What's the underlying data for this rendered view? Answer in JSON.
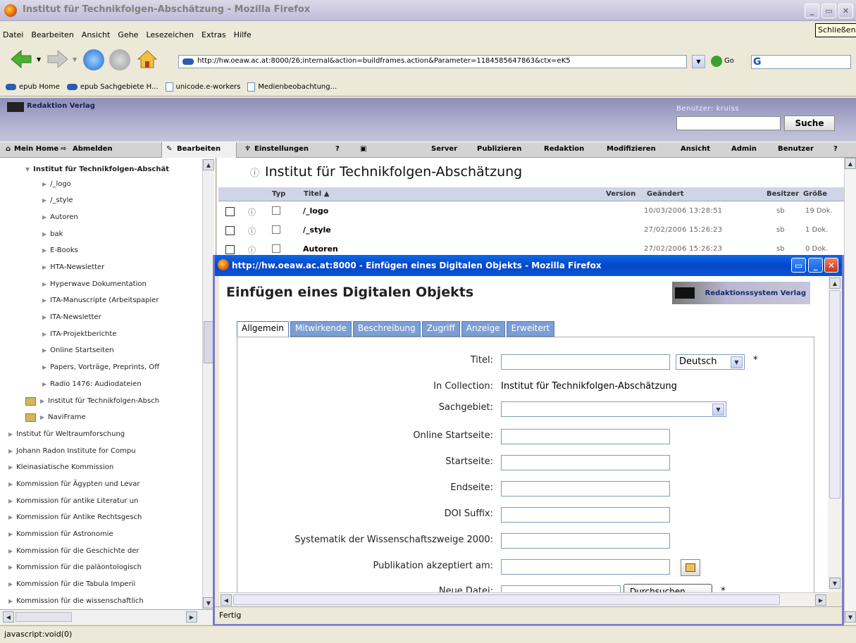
{
  "window": {
    "title": "Institut für Technikfolgen-Abschätzung - Mozilla Firefox",
    "tooltip": "Schließen"
  },
  "menu": [
    "Datei",
    "Bearbeiten",
    "Ansicht",
    "Gehe",
    "Lesezeichen",
    "Extras",
    "Hilfe"
  ],
  "nav": {
    "url": "http://hw.oeaw.ac.at:8000/26;internal&action=buildframes.action&Parameter=1184585647863&ctx=eK5",
    "go_label": "Go"
  },
  "bookmarks": [
    "epub Home",
    "epub Sachgebiete H...",
    "unicode.e-workers",
    "Medienbeobachtung..."
  ],
  "site": {
    "logo_text": "Redaktion Verlag",
    "user_label": "Benutzer: kruiss",
    "search_button": "Suche"
  },
  "appmenu": {
    "left": [
      "Mein Home",
      "Abmelden",
      "Bearbeiten",
      "Einstellungen"
    ],
    "right": [
      "Server",
      "Publizieren",
      "Redaktion",
      "Modifizieren",
      "Ansicht",
      "Admin",
      "Benutzer",
      "?"
    ]
  },
  "tree": {
    "items": [
      "Institut für Technikfolgen-Abschät",
      "/_logo",
      "/_style",
      "Autoren",
      "bak",
      "E-Books",
      "HTA-Newsletter",
      "Hyperwave Dokumentation",
      "ITA-Manuscripte (Arbeitspapier",
      "ITA-Newsletter",
      "ITA-Projektberichte",
      "Online Startseiten",
      "Papers, Vorträge, Preprints, Off",
      "Radio 1476: Audiodateien",
      "Institut für Technikfolgen-Absch",
      "NaviFrame",
      "Institut für Weltraumforschung",
      "Johann Radon Institute for Compu",
      "Kleinasiatische Kommission",
      "Kommission für Ägypten und Levar",
      "Kommission für antike Literatur un",
      "Kommission für Antike Rechtsgesch",
      "Kommission für Astronomie",
      "Kommission für die Geschichte der",
      "Kommission für die paläontologisch",
      "Kommission für die Tabula Imperii",
      "Kommission für die wissenschaftlich"
    ]
  },
  "main": {
    "title": "Institut für Technikfolgen-Abschätzung",
    "columns": {
      "typ": "Typ",
      "titel": "Titel ▲",
      "version": "Version",
      "geaendert": "Geändert",
      "besitzer": "Besitzer",
      "groesse": "Größe"
    },
    "rows": [
      {
        "name": "/_logo",
        "date": "10/03/2006 13:28:51",
        "owner": "sb",
        "size": "19 Dok."
      },
      {
        "name": "/_style",
        "date": "27/02/2006 15:26:23",
        "owner": "sb",
        "size": "1 Dok."
      },
      {
        "name": "Autoren",
        "date": "27/02/2006 15:26:23",
        "owner": "sb",
        "size": "0 Dok."
      }
    ]
  },
  "popup": {
    "title": "http://hw.oeaw.ac.at:8000 - Einfügen eines Digitalen Objekts - Mozilla Firefox",
    "heading": "Einfügen eines Digitalen Objekts",
    "logo_text": "Redaktionssystem Verlag",
    "tabs": [
      "Allgemein",
      "Mitwirkende",
      "Beschreibung",
      "Zugriff",
      "Anzeige",
      "Erweitert"
    ],
    "form": {
      "titel": "Titel:",
      "lang_value": "Deutsch",
      "required": "*",
      "in_collection": "In Collection:",
      "collection_value": "Institut für Technikfolgen-Abschätzung",
      "sachgebiet": "Sachgebiet:",
      "online_startseite": "Online Startseite:",
      "startseite": "Startseite:",
      "endseite": "Endseite:",
      "doi_suffix": "DOI Suffix:",
      "systematik": "Systematik der Wissenschaftszweige 2000:",
      "publikation": "Publikation akzeptiert am:",
      "neue_datei": "Neue Datei:",
      "browse": "Durchsuchen..."
    },
    "status": "Fertig"
  },
  "statusbar": "javascript:void(0)"
}
